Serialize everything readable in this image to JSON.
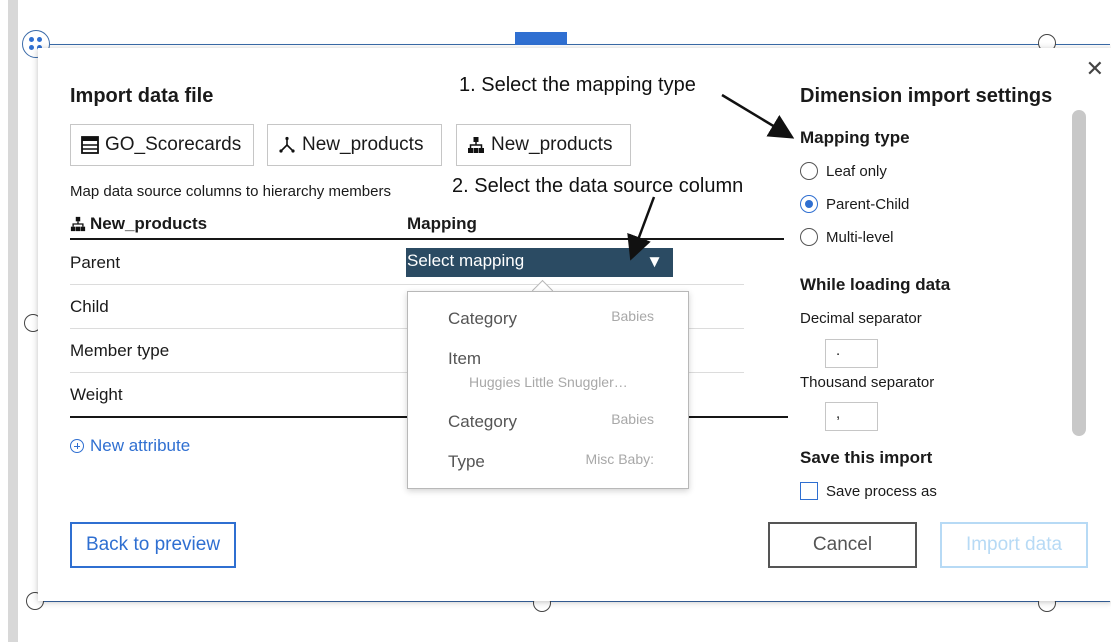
{
  "dialog": {
    "title": "Import data file",
    "close_glyph": "✕",
    "sources": [
      {
        "label": "GO_Scorecards",
        "icon": "table-icon"
      },
      {
        "label": "New_products",
        "icon": "hierarchy-branch-icon"
      },
      {
        "label": "New_products",
        "icon": "hierarchy-tree-icon"
      }
    ],
    "map_caption": "Map data source columns to hierarchy members",
    "table": {
      "header_members": "New_products",
      "header_mapping": "Mapping",
      "rows": [
        "Parent",
        "Child",
        "Member type",
        "Weight"
      ],
      "select_placeholder": "Select mapping",
      "select_arrow": "▼"
    },
    "new_attribute": "New attribute",
    "dropdown_options": [
      {
        "label": "Category",
        "sample": "Babies"
      },
      {
        "label": "Item",
        "sample": "Huggies Little Snuggler…"
      },
      {
        "label": "Category",
        "sample": "Babies"
      },
      {
        "label": "Type",
        "sample": "Misc Baby:"
      }
    ]
  },
  "settings": {
    "title": "Dimension import settings",
    "mapping_type_heading": "Mapping type",
    "mapping_options": [
      {
        "label": "Leaf only",
        "checked": false
      },
      {
        "label": "Parent-Child",
        "checked": true
      },
      {
        "label": "Multi-level",
        "checked": false
      }
    ],
    "loading_heading": "While loading data",
    "decimal_label": "Decimal separator",
    "decimal_value": ".",
    "thousand_label": "Thousand separator",
    "thousand_value": ",",
    "save_heading": "Save this import",
    "save_checkbox_label": "Save process as",
    "save_checked": false
  },
  "buttons": {
    "back": "Back to preview",
    "cancel": "Cancel",
    "import": "Import data"
  },
  "annotations": {
    "step1": "1. Select the mapping type",
    "step2": "2. Select the data source column"
  },
  "colors": {
    "accent": "#2f6fd1",
    "select_bg": "#2b4b63",
    "disabled": "#b7daf5"
  }
}
